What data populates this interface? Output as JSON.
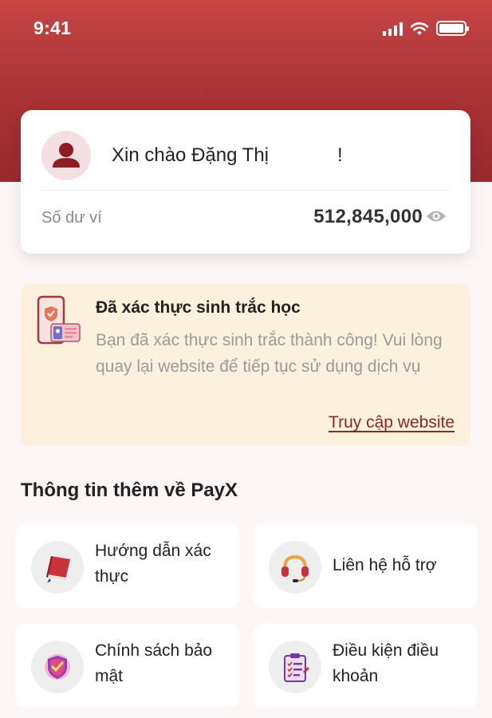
{
  "status_bar": {
    "time": "9:41"
  },
  "user_card": {
    "greeting_prefix": "Xin chào Đặng Thị",
    "greeting_suffix": "!",
    "balance_label": "Số dư ví",
    "balance_value": "512,845,000"
  },
  "biometric_card": {
    "title": "Đã xác thực sinh trắc học",
    "description": "Bạn đã xác thực sinh trắc thành công! Vui lòng quay lại website để tiếp tục sử dụng dịch vụ",
    "link_label": "Truy cập website"
  },
  "more_info": {
    "title": "Thông tin thêm về PayX",
    "items": [
      {
        "label": "Hướng dẫn xác thực",
        "icon": "book-icon"
      },
      {
        "label": "Liên hệ hỗ trợ",
        "icon": "headset-icon"
      },
      {
        "label": "Chính sách bảo mật",
        "icon": "shield-check-icon"
      },
      {
        "label": "Điều kiện điều khoản",
        "icon": "clipboard-icon"
      }
    ]
  },
  "colors": {
    "header_top": "#c64545",
    "header_bottom": "#982a2c",
    "link": "#8e2626",
    "notice_bg": "#fcf1dc"
  }
}
